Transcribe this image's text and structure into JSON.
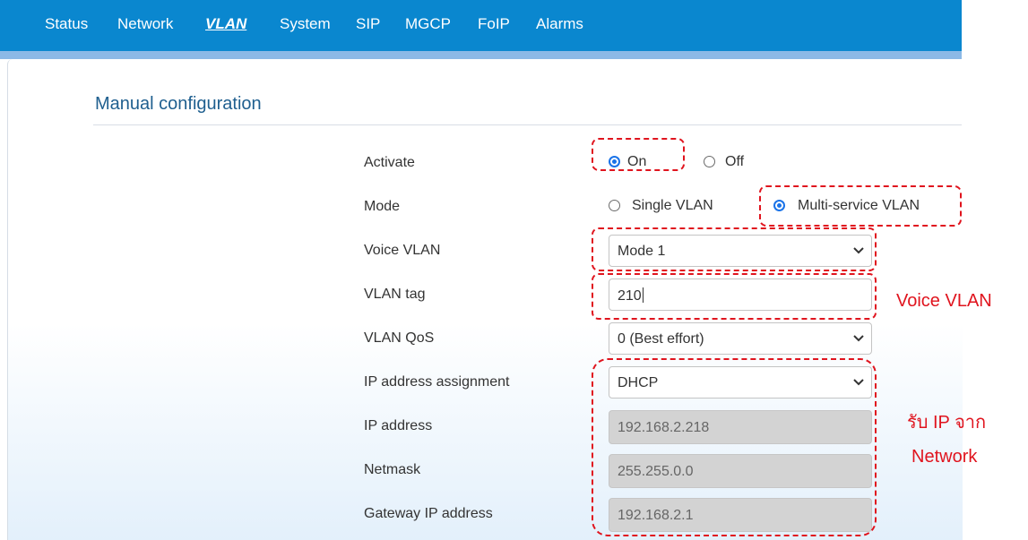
{
  "nav": {
    "items": [
      {
        "label": "Status"
      },
      {
        "label": "Network"
      },
      {
        "label": "VLAN"
      },
      {
        "label": "System"
      },
      {
        "label": "SIP"
      },
      {
        "label": "MGCP"
      },
      {
        "label": "FoIP"
      },
      {
        "label": "Alarms"
      }
    ],
    "active": "VLAN"
  },
  "section": {
    "title": "Manual configuration"
  },
  "form": {
    "activate": {
      "label": "Activate",
      "options": [
        "On",
        "Off"
      ],
      "selected": "On"
    },
    "mode": {
      "label": "Mode",
      "options": [
        "Single VLAN",
        "Multi-service VLAN"
      ],
      "selected": "Multi-service VLAN"
    },
    "voice_vlan": {
      "label": "Voice VLAN",
      "value": "Mode 1"
    },
    "vlan_tag": {
      "label": "VLAN tag",
      "value": "210"
    },
    "vlan_qos": {
      "label": "VLAN QoS",
      "value": "0 (Best effort)"
    },
    "ip_assignment": {
      "label": "IP address assignment",
      "value": "DHCP"
    },
    "ip_address": {
      "label": "IP address",
      "value": "192.168.2.218"
    },
    "netmask": {
      "label": "Netmask",
      "value": "255.255.0.0"
    },
    "gateway": {
      "label": "Gateway IP address",
      "value": "192.168.2.1"
    }
  },
  "annotations": {
    "voice_vlan": "Voice VLAN",
    "dhcp_line1": "รับ IP จาก",
    "dhcp_line2": "Network"
  },
  "colors": {
    "nav_bg": "#0a87cf",
    "accent_radio": "#1a73e8",
    "annotation": "#e0141e",
    "section_title": "#1f5f8f",
    "readonly_field": "#d3d3d3"
  }
}
